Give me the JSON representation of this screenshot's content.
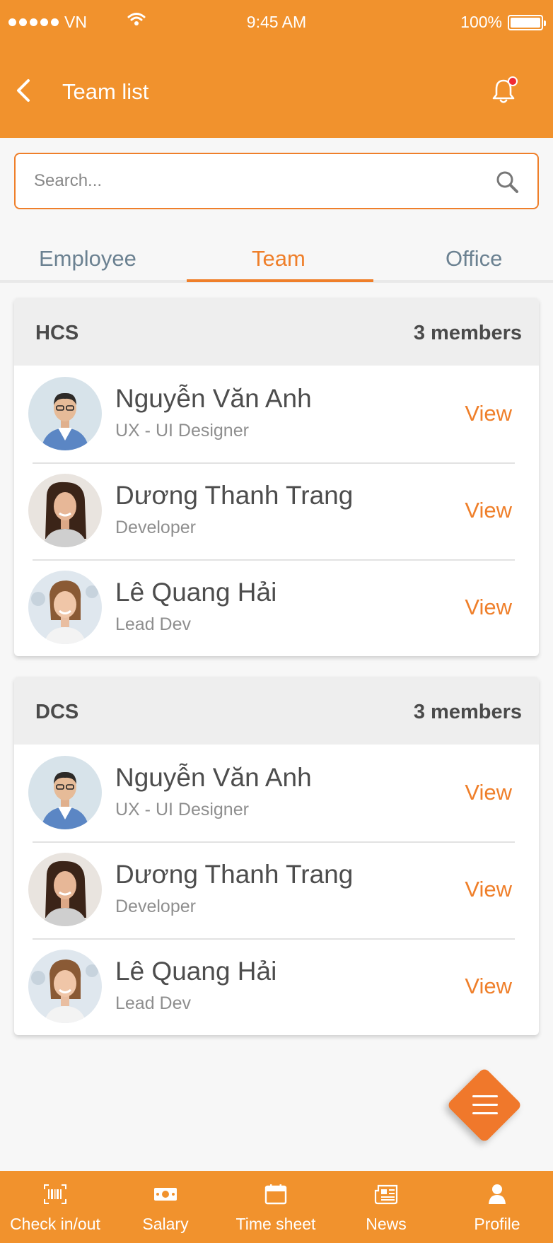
{
  "status_bar": {
    "carrier": "VN",
    "time": "9:45 AM",
    "battery": "100%"
  },
  "header": {
    "title": "Team list"
  },
  "search": {
    "placeholder": "Search..."
  },
  "tabs": [
    {
      "label": "Employee",
      "active": false
    },
    {
      "label": "Team",
      "active": true
    },
    {
      "label": "Office",
      "active": false
    }
  ],
  "groups": [
    {
      "name": "HCS",
      "count": "3 members",
      "members": [
        {
          "name": "Nguyễn Văn Anh",
          "role": "UX - UI Designer",
          "action": "View"
        },
        {
          "name": "Dương Thanh Trang",
          "role": "Developer",
          "action": "View"
        },
        {
          "name": "Lê Quang Hải",
          "role": "Lead Dev",
          "action": "View"
        }
      ]
    },
    {
      "name": "DCS",
      "count": "3 members",
      "members": [
        {
          "name": "Nguyễn Văn Anh",
          "role": "UX - UI Designer",
          "action": "View"
        },
        {
          "name": "Dương Thanh Trang",
          "role": "Developer",
          "action": "View"
        },
        {
          "name": "Lê Quang Hải",
          "role": "Lead Dev",
          "action": "View"
        }
      ]
    }
  ],
  "bottom_nav": [
    {
      "label": "Check in/out",
      "icon": "barcode-icon"
    },
    {
      "label": "Salary",
      "icon": "money-icon"
    },
    {
      "label": "Time sheet",
      "icon": "calendar-icon"
    },
    {
      "label": "News",
      "icon": "newspaper-icon"
    },
    {
      "label": "Profile",
      "icon": "person-icon"
    }
  ],
  "colors": {
    "accent": "#f1922d",
    "accent_text": "#ef7f2a",
    "notification": "#f12b35"
  }
}
